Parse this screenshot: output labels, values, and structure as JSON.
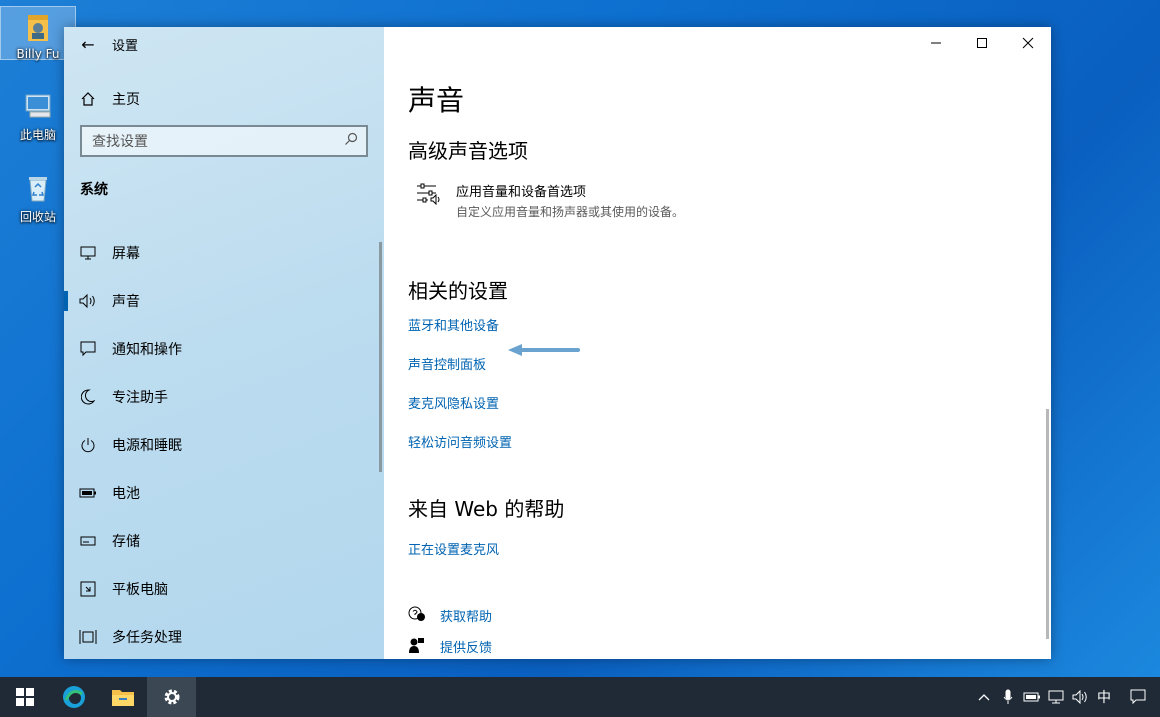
{
  "desktop": {
    "icons": [
      {
        "label": "Billy Fu"
      },
      {
        "label": "此电脑"
      },
      {
        "label": "回收站"
      }
    ]
  },
  "window": {
    "title": "设置",
    "sidebar": {
      "home": "主页",
      "search_placeholder": "查找设置",
      "section": "系统",
      "items": [
        {
          "label": "屏幕",
          "icon": "monitor-icon"
        },
        {
          "label": "声音",
          "icon": "speaker-icon"
        },
        {
          "label": "通知和操作",
          "icon": "notification-icon"
        },
        {
          "label": "专注助手",
          "icon": "moon-icon"
        },
        {
          "label": "电源和睡眠",
          "icon": "power-icon"
        },
        {
          "label": "电池",
          "icon": "battery-icon"
        },
        {
          "label": "存储",
          "icon": "storage-icon"
        },
        {
          "label": "平板电脑",
          "icon": "tablet-icon"
        },
        {
          "label": "多任务处理",
          "icon": "multitask-icon"
        }
      ],
      "active_item": "声音"
    },
    "content": {
      "title": "声音",
      "advanced": {
        "heading": "高级声音选项",
        "option_title": "应用音量和设备首选项",
        "option_desc": "自定义应用音量和扬声器或其使用的设备。"
      },
      "related": {
        "heading": "相关的设置",
        "links": [
          "蓝牙和其他设备",
          "声音控制面板",
          "麦克风隐私设置",
          "轻松访问音频设置"
        ]
      },
      "web_help": {
        "heading": "来自 Web 的帮助",
        "link": "正在设置麦克风"
      },
      "footer": {
        "get_help": "获取帮助",
        "feedback": "提供反馈"
      }
    }
  },
  "taskbar": {
    "tray_ime": "中"
  },
  "colors": {
    "accent": "#0063b1",
    "taskbar": "#1f2a36"
  }
}
